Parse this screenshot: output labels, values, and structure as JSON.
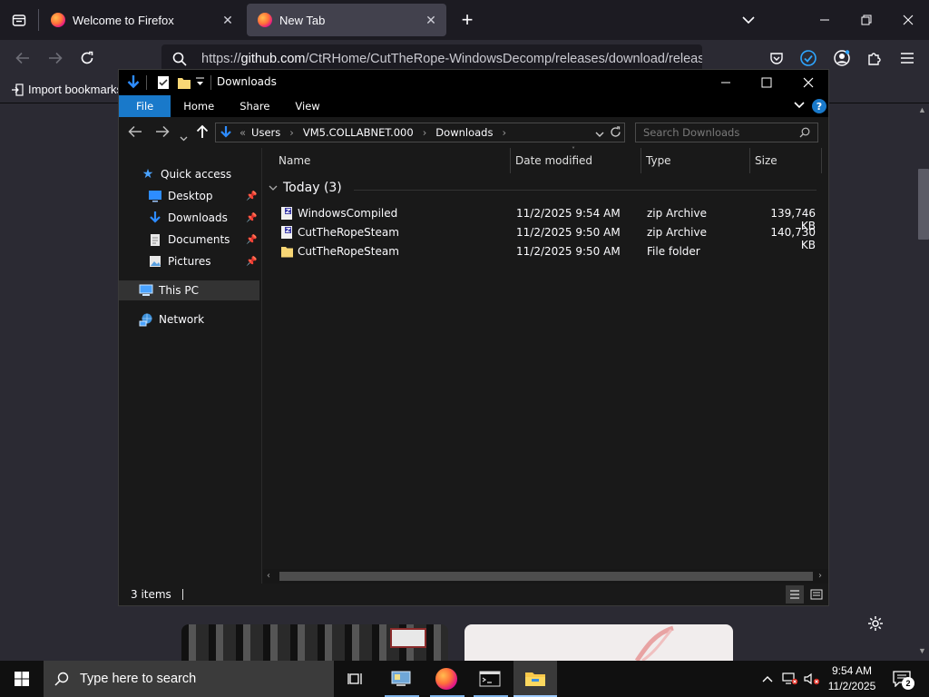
{
  "firefox": {
    "tabs": [
      {
        "label": "Welcome to Firefox"
      },
      {
        "label": "New Tab"
      }
    ],
    "url_prefix": "https://",
    "url_host": "github.com",
    "url_path": "/CtRHome/CutTheRope-WindowsDecomp/releases/download/release/",
    "bookmark_label": "Import bookmarks..."
  },
  "explorer": {
    "title": "Downloads",
    "ribbon_tabs": [
      "File",
      "Home",
      "Share",
      "View"
    ],
    "breadcrumb": [
      "Users",
      "VM5.COLLABNET.000",
      "Downloads"
    ],
    "search_placeholder": "Search Downloads",
    "nav": {
      "quick_access": "Quick access",
      "items": [
        "Desktop",
        "Downloads",
        "Documents",
        "Pictures"
      ],
      "this_pc": "This PC",
      "network": "Network"
    },
    "columns": [
      "Name",
      "Date modified",
      "Type",
      "Size"
    ],
    "group_label": "Today (3)",
    "files": [
      {
        "name": "WindowsCompiled",
        "date": "11/2/2025 9:54 AM",
        "type": "zip Archive",
        "size": "139,746 KB",
        "kind": "zip"
      },
      {
        "name": "CutTheRopeSteam",
        "date": "11/2/2025 9:50 AM",
        "type": "zip Archive",
        "size": "140,730 KB",
        "kind": "zip"
      },
      {
        "name": "CutTheRopeSteam",
        "date": "11/2/2025 9:50 AM",
        "type": "File folder",
        "size": "",
        "kind": "folder"
      }
    ],
    "status": "3 items"
  },
  "taskbar": {
    "search_placeholder": "Type here to search",
    "time": "9:54 AM",
    "date": "11/2/2025",
    "notification_count": "2"
  },
  "colors": {
    "accent": "#1979ca",
    "selected_nav": "#333333"
  }
}
